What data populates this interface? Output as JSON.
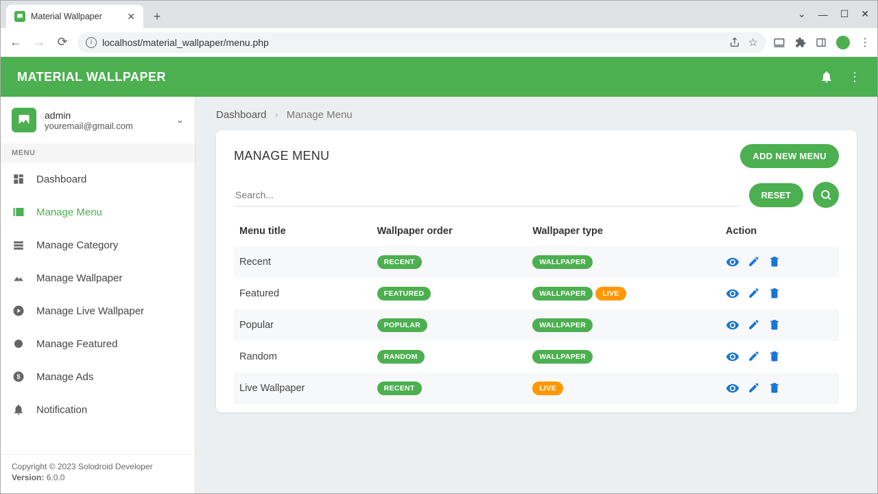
{
  "browser": {
    "tab_title": "Material Wallpaper",
    "url": "localhost/material_wallpaper/menu.php"
  },
  "header": {
    "brand": "MATERIAL WALLPAPER"
  },
  "user": {
    "name": "admin",
    "email": "youremail@gmail.com"
  },
  "sidebar": {
    "section_label": "MENU",
    "items": [
      {
        "label": "Dashboard"
      },
      {
        "label": "Manage Menu"
      },
      {
        "label": "Manage Category"
      },
      {
        "label": "Manage Wallpaper"
      },
      {
        "label": "Manage Live Wallpaper"
      },
      {
        "label": "Manage Featured"
      },
      {
        "label": "Manage Ads"
      },
      {
        "label": "Notification"
      }
    ],
    "footer": {
      "copyright": "Copyright © 2023 Solodroid Developer",
      "version_label": "Version:",
      "version": "6.0.0"
    }
  },
  "breadcrumbs": {
    "root": "Dashboard",
    "current": "Manage Menu"
  },
  "card": {
    "title": "MANAGE MENU",
    "add_button": "ADD NEW MENU",
    "search_placeholder": "Search...",
    "reset_button": "RESET"
  },
  "table": {
    "columns": {
      "title": "Menu title",
      "order": "Wallpaper order",
      "type": "Wallpaper type",
      "action": "Action"
    },
    "rows": [
      {
        "title": "Recent",
        "order": [
          "RECENT"
        ],
        "type": [
          {
            "text": "WALLPAPER",
            "color": "green"
          }
        ]
      },
      {
        "title": "Featured",
        "order": [
          "FEATURED"
        ],
        "type": [
          {
            "text": "WALLPAPER",
            "color": "green"
          },
          {
            "text": "LIVE",
            "color": "orange"
          }
        ]
      },
      {
        "title": "Popular",
        "order": [
          "POPULAR"
        ],
        "type": [
          {
            "text": "WALLPAPER",
            "color": "green"
          }
        ]
      },
      {
        "title": "Random",
        "order": [
          "RANDOM"
        ],
        "type": [
          {
            "text": "WALLPAPER",
            "color": "green"
          }
        ]
      },
      {
        "title": "Live Wallpaper",
        "order": [
          "RECENT"
        ],
        "type": [
          {
            "text": "LIVE",
            "color": "orange"
          }
        ]
      }
    ]
  }
}
